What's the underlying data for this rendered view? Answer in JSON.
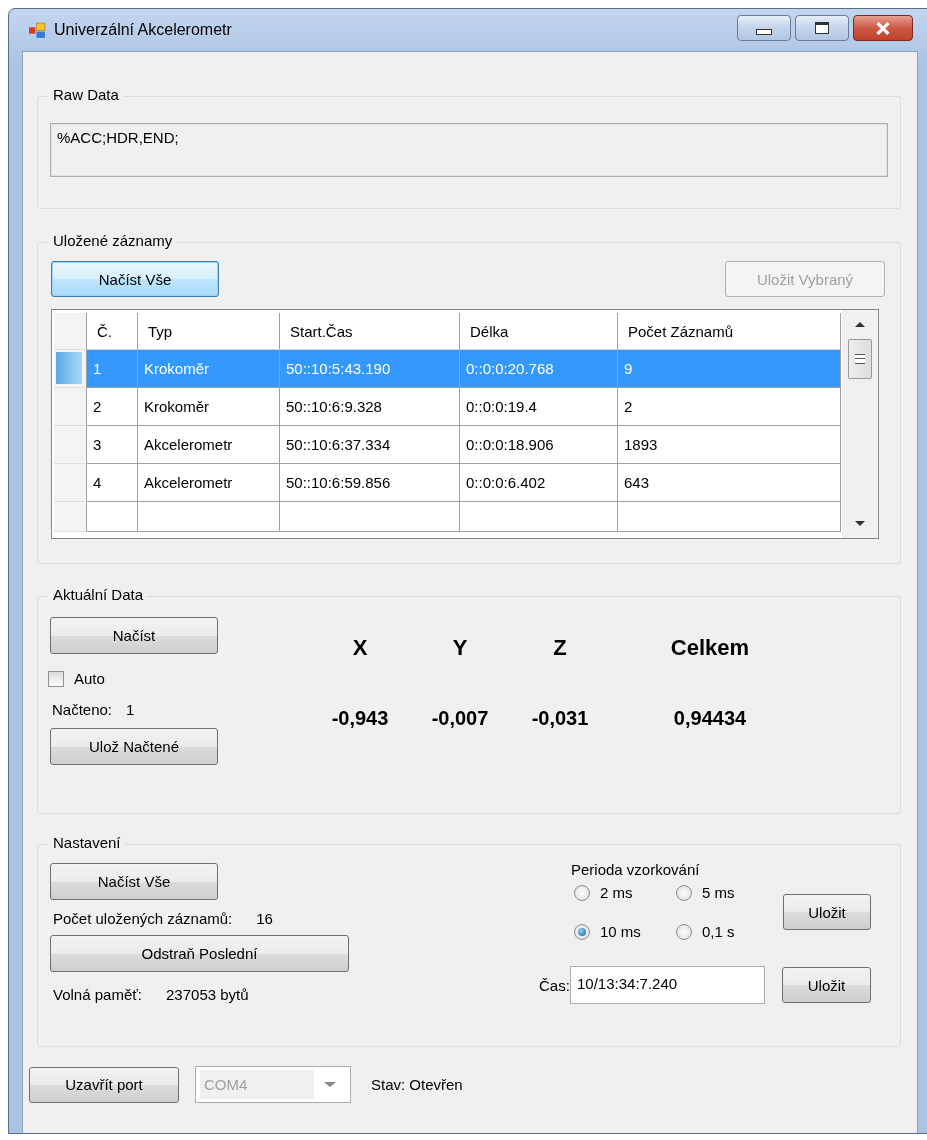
{
  "window": {
    "title": "Univerzální Akcelerometr"
  },
  "raw_data": {
    "title": "Raw Data",
    "value": "%ACC;HDR,END;"
  },
  "saved_records": {
    "title": "Uložené záznamy",
    "load_all_button": {
      "label": "Načíst Vše",
      "focused": true
    },
    "save_selected_button": {
      "label": "Uložit Vybraný",
      "disabled": true
    },
    "table": {
      "columns": [
        "Č.",
        "Typ",
        "Start.Čas",
        "Délka",
        "Počet Záznamů"
      ],
      "rows": [
        {
          "cells": [
            "1",
            "Krokoměr",
            "50::10:5:43.190",
            "0::0:0:20.768",
            "9"
          ],
          "selected": true
        },
        {
          "cells": [
            "2",
            "Krokoměr",
            "50::10:6:9.328",
            "0::0:0:19.4",
            "2"
          ],
          "selected": false
        },
        {
          "cells": [
            "3",
            "Akcelerometr",
            "50::10:6:37.334",
            "0::0:0:18.906",
            "1893"
          ],
          "selected": false
        },
        {
          "cells": [
            "4",
            "Akcelerometr",
            "50::10:6:59.856",
            "0::0:0:6.402",
            "643"
          ],
          "selected": false
        }
      ]
    }
  },
  "current_data": {
    "title": "Aktuální Data",
    "load_button": {
      "label": "Načíst"
    },
    "auto_checkbox": {
      "label": "Auto",
      "checked": false
    },
    "loaded_label": "Načteno:",
    "loaded_value": "1",
    "save_loaded_button": {
      "label": "Ulož Načtené"
    },
    "axes": [
      {
        "label": "X",
        "value": "-0,943"
      },
      {
        "label": "Y",
        "value": "-0,007"
      },
      {
        "label": "Z",
        "value": "-0,031"
      },
      {
        "label": "Celkem",
        "value": "0,94434"
      }
    ]
  },
  "settings": {
    "title": "Nastavení",
    "load_all_button": {
      "label": "Načíst Vše"
    },
    "count_label": "Počet uložených záznamů:",
    "count_value": "16",
    "delete_last_button": {
      "label": "Odstraň Poslední"
    },
    "free_memory_label": "Volná paměť:",
    "free_memory_value": "237053 bytů",
    "period_label": "Perioda vzorkování",
    "period_options": [
      {
        "label": "2 ms",
        "selected": false
      },
      {
        "label": "5 ms",
        "selected": false
      },
      {
        "label": "10 ms",
        "selected": true
      },
      {
        "label": "0,1 s",
        "selected": false
      }
    ],
    "period_save_button": {
      "label": "Uložit"
    },
    "time_label": "Čas:",
    "time_value": "10/13:34:7.240",
    "time_save_button": {
      "label": "Uložit"
    }
  },
  "footer": {
    "close_port_button": {
      "label": "Uzavřít port"
    },
    "port_select": {
      "value": "COM4",
      "disabled": true
    },
    "status": "Stav: Otevřen"
  }
}
